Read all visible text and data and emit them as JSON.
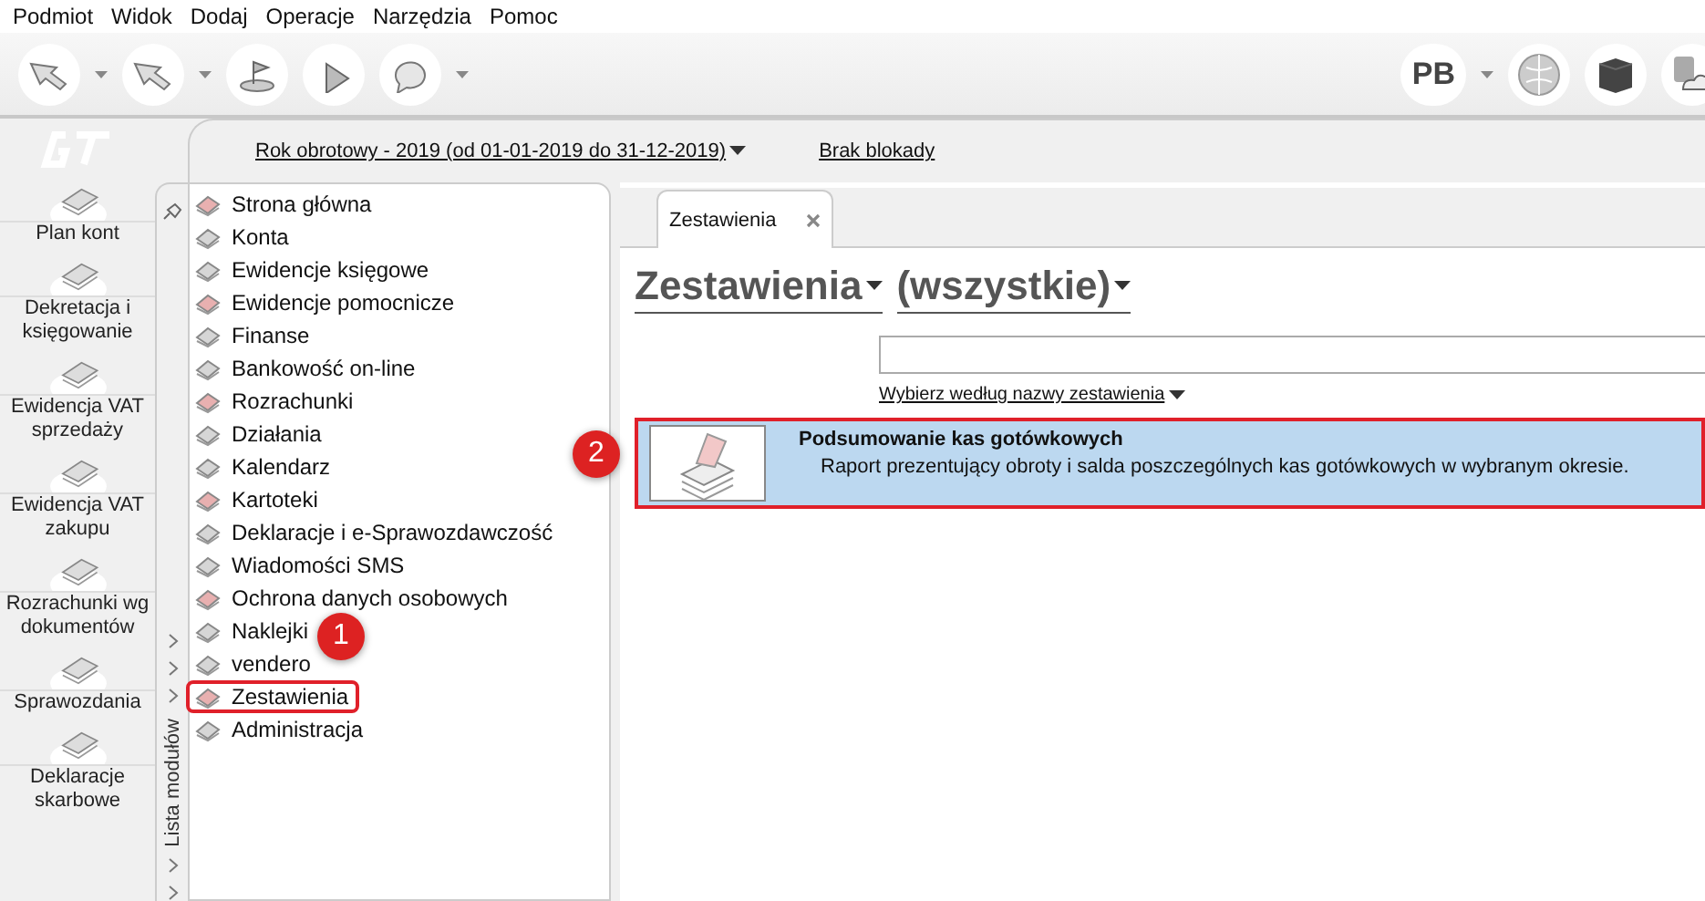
{
  "menu_bar": [
    "Podmiot",
    "Widok",
    "Dodaj",
    "Operacje",
    "Narzędzia",
    "Pomoc"
  ],
  "toolbar": {
    "user_badge": "PB"
  },
  "header": {
    "fiscal_year": "Rok obrotowy - 2019  (od 01-01-2019 do 31-12-2019)",
    "lock_status": "Brak blokady"
  },
  "shortcuts": [
    {
      "label": "Plan kont"
    },
    {
      "label": "Dekretacja i księgowanie"
    },
    {
      "label": "Ewidencja VAT sprzedaży"
    },
    {
      "label": "Ewidencja VAT zakupu"
    },
    {
      "label": "Rozrachunki wg dokumentów"
    },
    {
      "label": "Sprawozdania"
    },
    {
      "label": "Deklaracje skarbowe"
    }
  ],
  "module_list": {
    "title": "Lista modułów",
    "items": [
      {
        "label": "Strona główna",
        "outlined": false
      },
      {
        "label": "Konta",
        "outlined": false
      },
      {
        "label": "Ewidencje księgowe",
        "outlined": false
      },
      {
        "label": "Ewidencje pomocnicze",
        "outlined": false
      },
      {
        "label": "Finanse",
        "outlined": false
      },
      {
        "label": "Bankowość on-line",
        "outlined": false
      },
      {
        "label": "Rozrachunki",
        "outlined": false
      },
      {
        "label": "Działania",
        "outlined": false
      },
      {
        "label": "Kalendarz",
        "outlined": false
      },
      {
        "label": "Kartoteki",
        "outlined": false
      },
      {
        "label": "Deklaracje i e-Sprawozdawczość",
        "outlined": false
      },
      {
        "label": "Wiadomości SMS",
        "outlined": false
      },
      {
        "label": "Ochrona danych osobowych",
        "outlined": false
      },
      {
        "label": "Naklejki",
        "outlined": false
      },
      {
        "label": "vendero",
        "outlined": false
      },
      {
        "label": "Zestawienia",
        "outlined": true
      },
      {
        "label": "Administracja",
        "outlined": false
      }
    ]
  },
  "tabs": [
    {
      "label": "Zestawienia",
      "selected": true
    }
  ],
  "content": {
    "category": "Zestawienia",
    "filter": "(wszystkie)",
    "sort_link": "Wybierz według nazwy zestawienia",
    "reports": [
      {
        "title": "Podsumowanie kas gotówkowych",
        "description": "Raport prezentujący obroty i salda poszczególnych kas gotówkowych w wybranym okresie.",
        "selected": true,
        "outlined": true
      }
    ]
  },
  "annotations": [
    {
      "number": "1"
    },
    {
      "number": "2"
    }
  ]
}
